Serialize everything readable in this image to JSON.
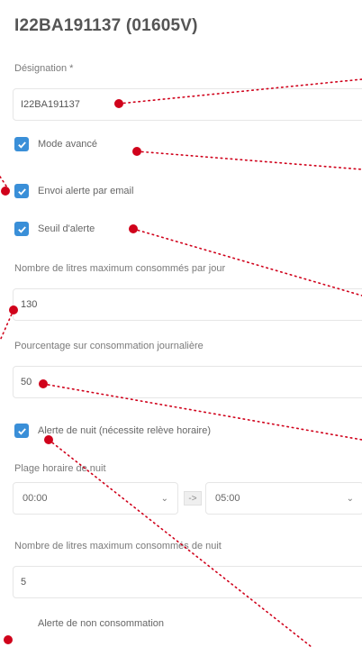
{
  "page": {
    "title": "I22BA191137 (01605V)"
  },
  "form": {
    "designation": {
      "label": "Désignation *",
      "value": "I22BA191137"
    },
    "mode_avance": {
      "label": "Mode avancé",
      "checked": true
    },
    "envoi_alerte": {
      "label": "Envoi alerte par email",
      "checked": true
    },
    "seuil_alerte": {
      "label": "Seuil d'alerte",
      "checked": true
    },
    "litres_max_jour": {
      "label": "Nombre de litres maximum consommés par jour",
      "value": "130"
    },
    "pourcentage": {
      "label": "Pourcentage sur consommation journalière",
      "value": "50"
    },
    "alerte_nuit": {
      "label": "Alerte de nuit (nécessite relève horaire)",
      "checked": true
    },
    "plage_horaire": {
      "label": "Plage horaire de nuit",
      "start": "00:00",
      "separator": "->",
      "end": "05:00"
    },
    "litres_max_nuit": {
      "label": "Nombre de litres maximum consommés de nuit",
      "value": "5"
    },
    "non_consommation": {
      "label": "Alerte de non consommation",
      "checked": false
    }
  },
  "icons": {
    "checkbox_checked": "check-icon",
    "select_arrow": "chevron-down-icon"
  },
  "colors": {
    "checkbox": "#3a8fd8",
    "annotation": "#d0021b"
  }
}
